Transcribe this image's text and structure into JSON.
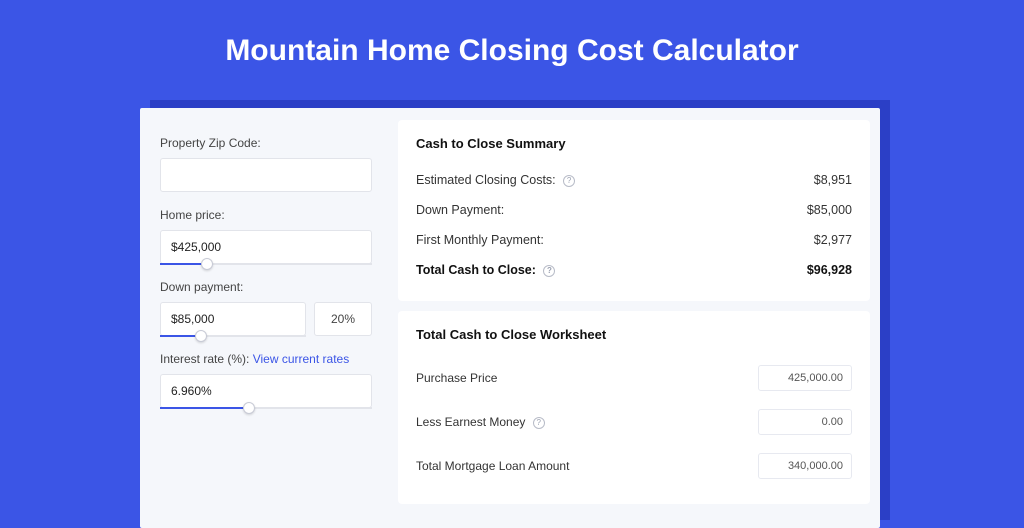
{
  "title": "Mountain Home Closing Cost Calculator",
  "left": {
    "zip": {
      "label": "Property Zip Code:",
      "value": ""
    },
    "price": {
      "label": "Home price:",
      "value": "$425,000",
      "slider_pct": 22
    },
    "down": {
      "label": "Down payment:",
      "value": "$85,000",
      "pct": "20%",
      "slider_pct": 28
    },
    "rate": {
      "label": "Interest rate (%):",
      "link": "View current rates",
      "value": "6.960%",
      "slider_pct": 42
    }
  },
  "summary": {
    "heading": "Cash to Close Summary",
    "rows": [
      {
        "label": "Estimated Closing Costs:",
        "help": true,
        "value": "$8,951"
      },
      {
        "label": "Down Payment:",
        "help": false,
        "value": "$85,000"
      },
      {
        "label": "First Monthly Payment:",
        "help": false,
        "value": "$2,977"
      }
    ],
    "total": {
      "label": "Total Cash to Close:",
      "help": true,
      "value": "$96,928"
    }
  },
  "worksheet": {
    "heading": "Total Cash to Close Worksheet",
    "rows": [
      {
        "label": "Purchase Price",
        "help": false,
        "value": "425,000.00"
      },
      {
        "label": "Less Earnest Money",
        "help": true,
        "value": "0.00"
      },
      {
        "label": "Total Mortgage Loan Amount",
        "help": false,
        "value": "340,000.00"
      }
    ]
  }
}
